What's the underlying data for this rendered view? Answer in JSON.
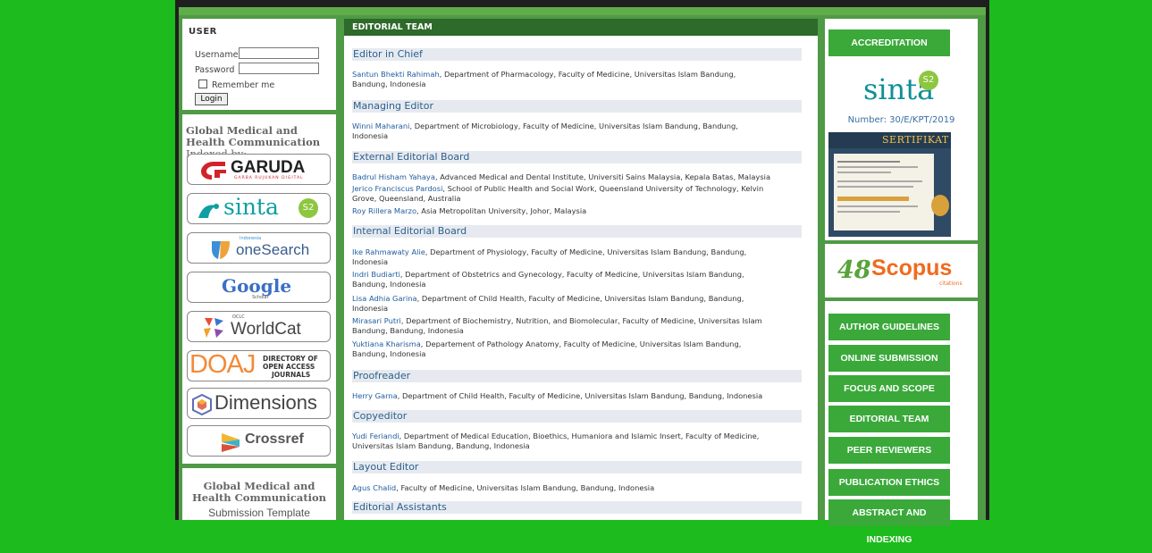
{
  "user_block": {
    "title": "USER",
    "username_label": "Username",
    "password_label": "Password",
    "remember_label": "Remember me",
    "login_label": "Login"
  },
  "indexed_block": {
    "title_bold": "Global Medical and Health Communication",
    "title_rest": " Indexed by:",
    "logos": [
      {
        "name": "GARUDA",
        "sub": "GARBA RUJUKAN DIGITAL"
      },
      {
        "name": "sinta",
        "badge": "S2"
      },
      {
        "name": "oneSearch",
        "small": "Indonesia"
      },
      {
        "name": "Google",
        "sub": "Scholar"
      },
      {
        "name": "WorldCat",
        "small": "OCLC"
      },
      {
        "name": "DOAJ",
        "sub1": "DIRECTORY OF",
        "sub2": "OPEN ACCESS",
        "sub3": "JOURNALS"
      },
      {
        "name": "Dimensions"
      },
      {
        "name": "Crossref"
      }
    ]
  },
  "template_block": {
    "title": "Global Medical and Health Communication",
    "subtitle": "Submission Template"
  },
  "main": {
    "header": "EDITORIAL TEAM",
    "sections": [
      {
        "title": "Editor in Chief",
        "entries": [
          {
            "name": "Santun Bhekti Rahimah",
            "line1": ", Department of Pharmacology, Faculty of Medicine, Universitas Islam Bandung,",
            "line2": "Bandung, Indonesia"
          }
        ]
      },
      {
        "title": "Managing Editor",
        "entries": [
          {
            "name": "Winni Maharani",
            "line1": ", Department of Microbiology, Faculty of Medicine, Universitas Islam Bandung, Bandung,",
            "line2": "Indonesia"
          }
        ]
      },
      {
        "title": "External Editorial Board",
        "entries": [
          {
            "name": "Badrul Hisham Yahaya",
            "line1": ", Advanced Medical and Dental Institute, Universiti Sains Malaysia, Kepala Batas, Malaysia",
            "line2": ""
          },
          {
            "name": "Jerico Franciscus Pardosi",
            "line1": ", School of Public Health and Social Work, Queensland University of Technology, Kelvin",
            "line2": "Grove, Queensland, Australia"
          },
          {
            "name": "Roy Rillera Marzo",
            "line1": ", Asia Metropolitan University, Johor, Malaysia",
            "line2": ""
          }
        ]
      },
      {
        "title": "Internal Editorial Board",
        "entries": [
          {
            "name": "Ike Rahmawaty Alie",
            "line1": ", Department of Physiology, Faculty of Medicine, Universitas Islam Bandung, Bandung,",
            "line2": "Indonesia"
          },
          {
            "name": "Indri Budiarti",
            "line1": ", Department of Obstetrics and Gynecology, Faculty of Medicine, Universitas Islam Bandung,",
            "line2": "Bandung, Indonesia"
          },
          {
            "name": "Lisa Adhia Garina",
            "line1": ", Department of Child Health, Faculty of Medicine, Universitas Islam Bandung, Bandung,",
            "line2": "Indonesia"
          },
          {
            "name": "Mirasari Putri",
            "line1": ", Department of Biochemistry, Nutrition, and Biomolecular, Faculty of Medicine, Universitas Islam",
            "line2": "Bandung, Bandung, Indonesia"
          },
          {
            "name": "Yuktiana Kharisma",
            "line1": ", Departement of Pathology Anatomy, Faculty of Medicine, Universitas Islam Bandung,",
            "line2": "Bandung, Indonesia"
          }
        ]
      },
      {
        "title": "Proofreader",
        "entries": [
          {
            "name": "Herry Garna",
            "line1": ", Department of Child Health, Faculty of Medicine, Universitas Islam Bandung, Bandung, Indonesia",
            "line2": ""
          }
        ]
      },
      {
        "title": "Copyeditor",
        "entries": [
          {
            "name": "Yudi Feriandi",
            "line1": ", Department of Medical Education, Bioethics, Humaniora and Islamic Insert, Faculty of Medicine,",
            "line2": "Universitas Islam Bandung, Bandung, Indonesia"
          }
        ]
      },
      {
        "title": "Layout Editor",
        "entries": [
          {
            "name": "Agus Chalid",
            "line1": ", Faculty of Medicine, Universitas Islam Bandung, Bandung, Indonesia",
            "line2": ""
          }
        ]
      },
      {
        "title": "Editorial Assistants",
        "entries": []
      }
    ]
  },
  "right": {
    "accreditation_label": "ACCREDITATION",
    "sinta_logo": "sinta",
    "sinta_badge": "S2",
    "accreditation_number": "Number: 30/E/KPT/2019",
    "certificate_title": "SERTIFIKAT",
    "scopus_count": "48",
    "scopus_name": "Scopus",
    "scopus_sub": "citations",
    "nav": [
      "AUTHOR GUIDELINES",
      "ONLINE SUBMISSION",
      "FOCUS AND SCOPE",
      "EDITORIAL TEAM",
      "PEER REVIEWERS",
      "PUBLICATION ETHICS",
      "ABSTRACT AND INDEXING"
    ]
  },
  "colors": {
    "page_bg": "#1dbb1d",
    "frame_green": "#4f9a45",
    "header_green": "#2e6a2a",
    "button_green": "#3aa93a",
    "link_blue": "#1f5b9e",
    "section_bg": "#e6eaf0"
  }
}
